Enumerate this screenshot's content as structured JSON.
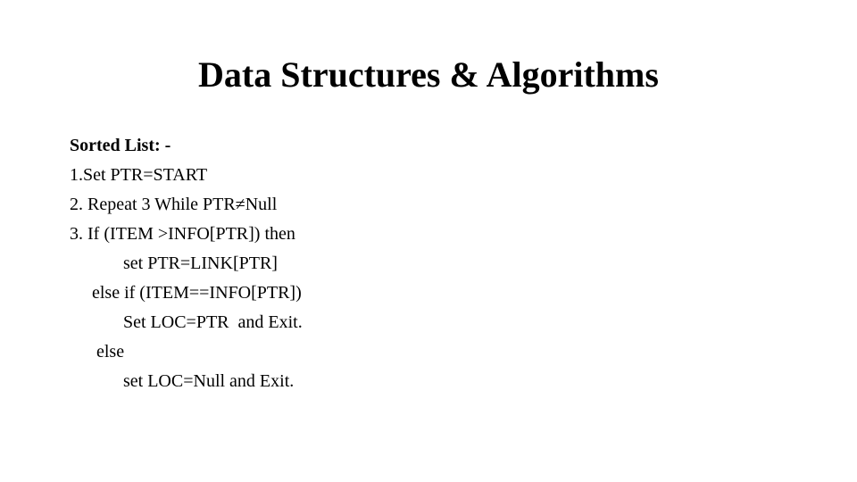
{
  "title": "Data Structures & Algorithms",
  "heading": "Sorted List: -",
  "lines": {
    "l1": "1.Set PTR=START",
    "l2": "2. Repeat 3 While PTR≠Null",
    "l3": "3. If (ITEM >INFO[PTR]) then",
    "l4": "            set PTR=LINK[PTR]",
    "l5": "     else if (ITEM==INFO[PTR])",
    "l6": "            Set LOC=PTR  and Exit.",
    "l7": "      else",
    "l8": "            set LOC=Null and Exit."
  }
}
